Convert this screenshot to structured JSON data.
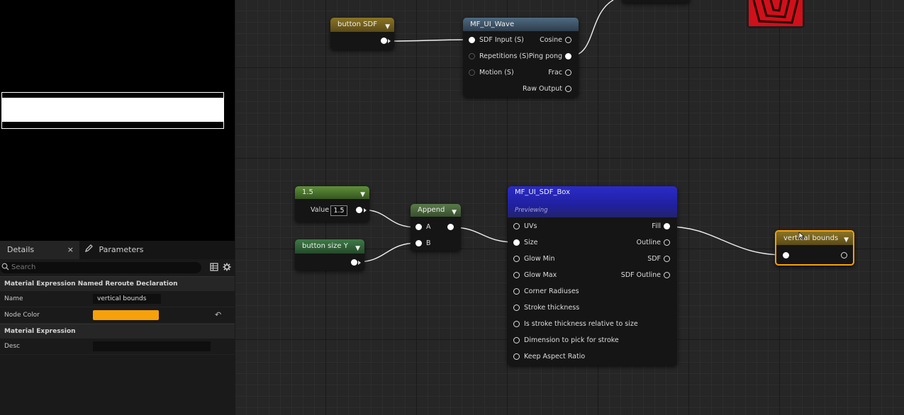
{
  "details": {
    "tab_details": "Details",
    "tab_close": "×",
    "tab_parameters": "Parameters",
    "search_placeholder": "Search",
    "section_named_reroute": "Material Expression Named Reroute Declaration",
    "name_label": "Name",
    "name_value": "vertical bounds",
    "node_color_label": "Node Color",
    "node_color_value": "#f7a10a",
    "section_material_expression": "Material Expression",
    "desc_label": "Desc",
    "desc_value": ""
  },
  "nodes": {
    "button_sdf": {
      "title": "button SDF"
    },
    "mf_ui_wave": {
      "title": "MF_UI_Wave",
      "inputs": [
        "SDF Input (S)",
        "Repetitions (S)",
        "Motion (S)"
      ],
      "outputs": [
        "Cosine",
        "Ping pong",
        "Frac",
        "Raw Output"
      ]
    },
    "const_1_5": {
      "title": "1.5",
      "value_label": "Value",
      "value": "1.5"
    },
    "button_size_y": {
      "title": "button size Y"
    },
    "append": {
      "title": "Append",
      "input_a": "A",
      "input_b": "B"
    },
    "mf_ui_sdf_box": {
      "title": "MF_UI_SDF_Box",
      "subtitle": "Previewing",
      "inputs": [
        "UVs",
        "Size",
        "Glow Min",
        "Glow Max",
        "Corner Radiuses",
        "Stroke thickness",
        "Is stroke thickness relative to size",
        "Dimension to pick for stroke",
        "Keep Aspect Ratio"
      ],
      "outputs": [
        "Fill",
        "Outline",
        "SDF",
        "SDF Outline"
      ]
    },
    "vertical_bounds": {
      "title": "vertical bounds"
    }
  },
  "colors": {
    "reroute_header": "#6b5a1e",
    "constant_header": "#3f6b2a",
    "param_header": "#2f5a35",
    "function_header": "#3a4b5e",
    "sdf_box_header": "#2a2ab8",
    "selection": "#f7a10a"
  }
}
